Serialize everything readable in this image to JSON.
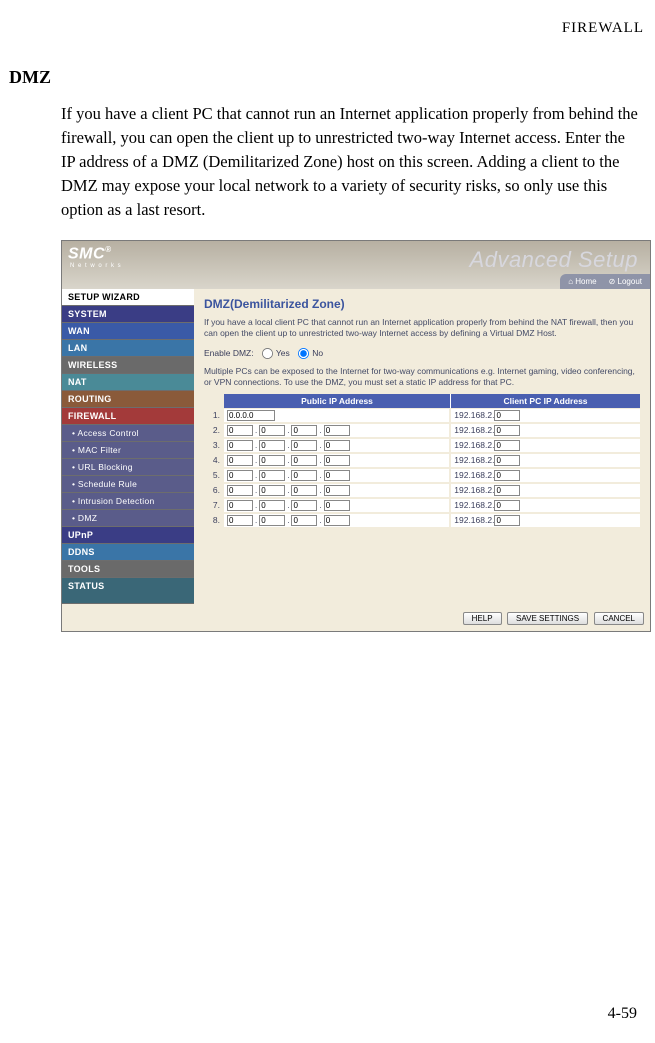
{
  "header": {
    "right": "FIREWALL"
  },
  "section": {
    "title": "DMZ",
    "body": "If you have a client PC that cannot run an Internet application properly from behind the firewall, you can open the client up to unrestricted two-way Internet access. Enter the IP address of a DMZ (Demilitarized Zone) host on this screen. Adding a client to the DMZ may expose your local network to a variety of security risks, so only use this option as a last resort."
  },
  "page_number": "4-59",
  "screenshot": {
    "banner": {
      "logo": "SMC",
      "logo_sub": "N e t w o r k s",
      "title": "Advanced Setup",
      "home": "Home",
      "logout": "Logout"
    },
    "nav": {
      "setup": "SETUP WIZARD",
      "items": [
        {
          "label": "SYSTEM",
          "cls": "c-system"
        },
        {
          "label": "WAN",
          "cls": "c-wan"
        },
        {
          "label": "LAN",
          "cls": "c-lan"
        },
        {
          "label": "WIRELESS",
          "cls": "c-wireless"
        },
        {
          "label": "NAT",
          "cls": "c-nat"
        },
        {
          "label": "ROUTING",
          "cls": "c-routing"
        },
        {
          "label": "FIREWALL",
          "cls": "c-firewall"
        }
      ],
      "subs": [
        {
          "label": "Access Control"
        },
        {
          "label": "MAC Filter"
        },
        {
          "label": "URL Blocking"
        },
        {
          "label": "Schedule Rule"
        },
        {
          "label": "Intrusion Detection"
        },
        {
          "label": "DMZ"
        }
      ],
      "items2": [
        {
          "label": "UPnP",
          "cls": "c-upnp"
        },
        {
          "label": "DDNS",
          "cls": "c-ddns"
        },
        {
          "label": "TOOLS",
          "cls": "c-tools"
        },
        {
          "label": "STATUS",
          "cls": "c-status"
        }
      ]
    },
    "content": {
      "heading": "DMZ(Demilitarized Zone)",
      "desc1": "If you have a local client PC that cannot run an Internet application properly from behind the NAT firewall, then you can open the client up to unrestricted two-way Internet access by defining a Virtual DMZ Host.",
      "enable_label": "Enable DMZ:",
      "yes": "Yes",
      "no": "No",
      "desc2": "Multiple PCs can be exposed to the Internet for two-way communications e.g. Internet gaming, video conferencing, or VPN connections.  To use the DMZ, you must set a static IP address for that PC.",
      "th_pub": "Public IP Address",
      "th_cli": "Client PC IP Address",
      "client_prefix": "192.168.2.",
      "rows": [
        {
          "n": "1.",
          "pub_full": "0.0.0.0",
          "client": "0"
        },
        {
          "n": "2.",
          "o1": "0",
          "o2": "0",
          "o3": "0",
          "o4": "0",
          "client": "0"
        },
        {
          "n": "3.",
          "o1": "0",
          "o2": "0",
          "o3": "0",
          "o4": "0",
          "client": "0"
        },
        {
          "n": "4.",
          "o1": "0",
          "o2": "0",
          "o3": "0",
          "o4": "0",
          "client": "0"
        },
        {
          "n": "5.",
          "o1": "0",
          "o2": "0",
          "o3": "0",
          "o4": "0",
          "client": "0"
        },
        {
          "n": "6.",
          "o1": "0",
          "o2": "0",
          "o3": "0",
          "o4": "0",
          "client": "0"
        },
        {
          "n": "7.",
          "o1": "0",
          "o2": "0",
          "o3": "0",
          "o4": "0",
          "client": "0"
        },
        {
          "n": "8.",
          "o1": "0",
          "o2": "0",
          "o3": "0",
          "o4": "0",
          "client": "0"
        }
      ],
      "btn_help": "HELP",
      "btn_save": "SAVE SETTINGS",
      "btn_cancel": "CANCEL"
    }
  }
}
